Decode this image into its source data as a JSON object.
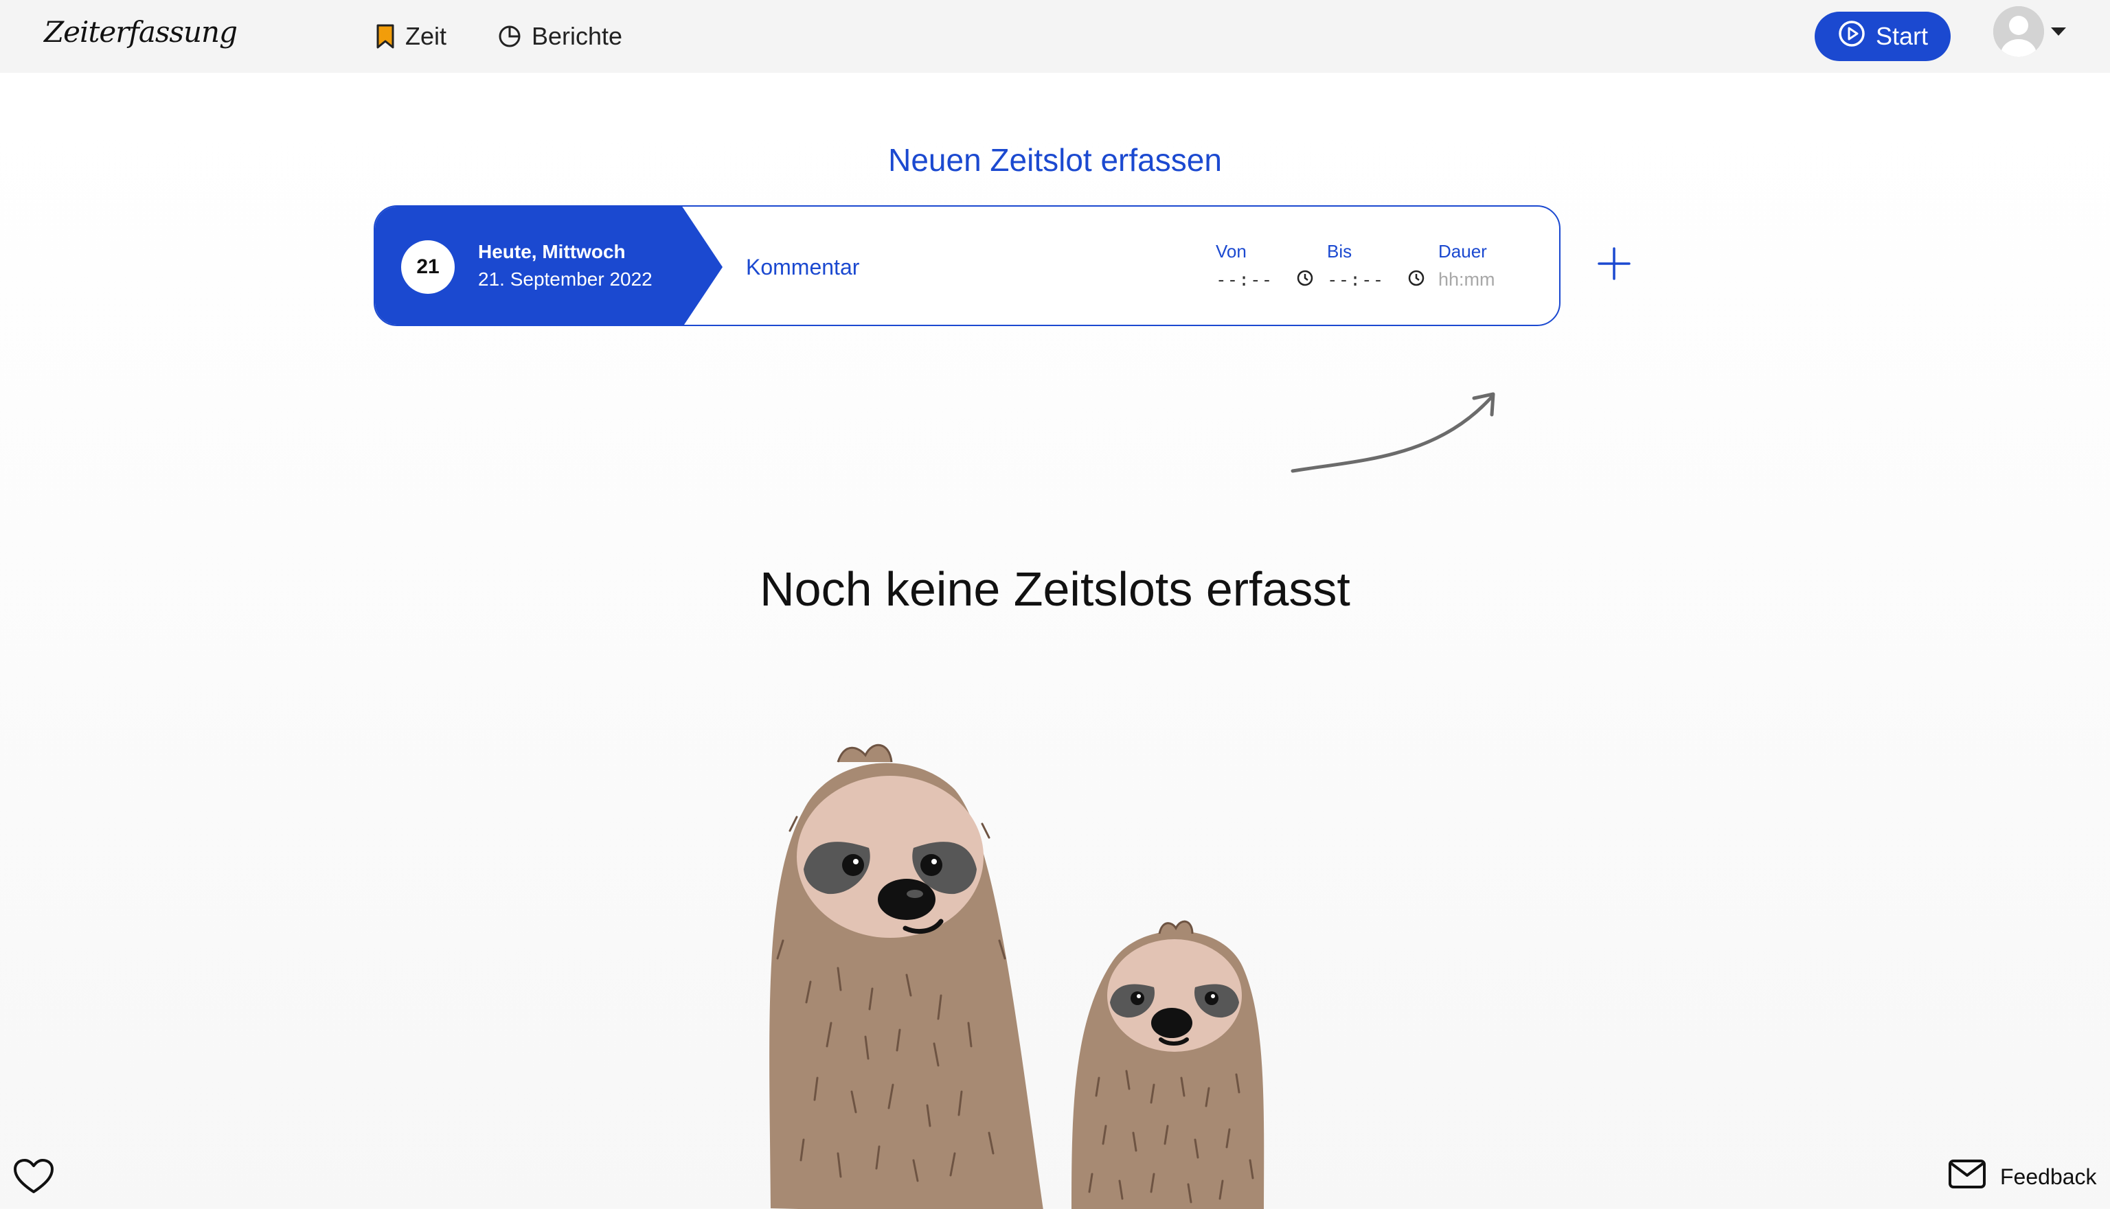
{
  "app": {
    "title": "Zeiterfassung"
  },
  "nav": [
    {
      "label": "Zeit",
      "icon": "bookmark-icon",
      "icon_color": "#f29d0a"
    },
    {
      "label": "Berichte",
      "icon": "pie-chart-icon"
    }
  ],
  "header": {
    "start_label": "Start",
    "accent_color": "#1b49d0"
  },
  "form": {
    "title": "Neuen Zeitslot erfassen",
    "day_number": "21",
    "day_label": "Heute, Mittwoch",
    "date_label": "21. September 2022",
    "comment_placeholder": "Kommentar",
    "from_label": "Von",
    "from_value": "--:--",
    "to_label": "Bis",
    "to_value": "--:--",
    "duration_label": "Dauer",
    "duration_placeholder": "hh:mm"
  },
  "empty_state": {
    "title": "Noch keine Zeitslots erfasst"
  },
  "footer": {
    "feedback_label": "Feedback"
  }
}
